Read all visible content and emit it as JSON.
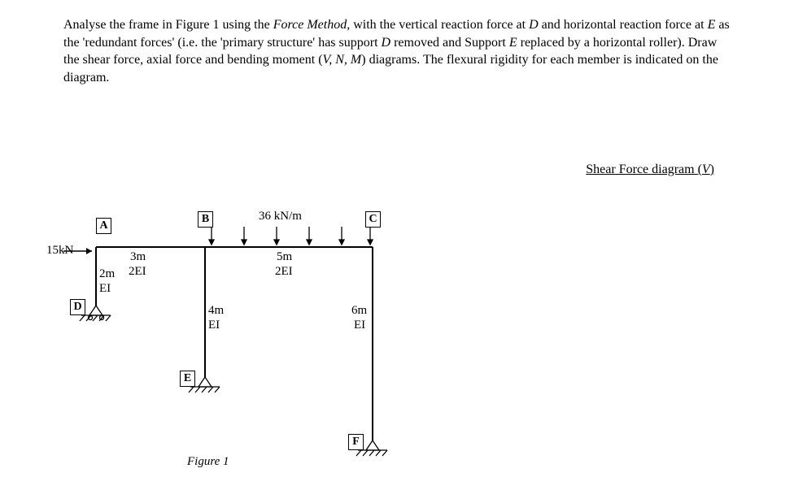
{
  "problem": {
    "p1a": "Analyse the frame in Figure 1 using the ",
    "p1b": "Force Method",
    "p1c": ", with the vertical reaction force at ",
    "p1d": "D",
    "p1e": " and horizontal reaction force at ",
    "p1f": "E",
    "p1g": " as the 'redundant forces' (i.e. the 'primary structure' has support ",
    "p1h": "D",
    "p1i": " removed and Support ",
    "p1j": "E",
    "p1k": " replaced by a horizontal roller). Draw the shear force, axial force and bending moment (",
    "p1l": "V, N, M",
    "p1m": ") diagrams. The flexural rigidity for each member is indicated on the diagram."
  },
  "shear_title": "Shear Force diagram (",
  "shear_v": "V",
  "shear_close": ")",
  "nodes": {
    "A": "A",
    "B": "B",
    "C": "C",
    "D": "D",
    "E": "E",
    "F": "F"
  },
  "labels": {
    "load15": "15kN",
    "udl": "36 kN/m",
    "ab_len": "3m",
    "ab_ei": "2EI",
    "ad_len": "2m",
    "ad_ei": "EI",
    "be_len": "4m",
    "be_ei": "EI",
    "bc_len": "5m",
    "bc_ei": "2EI",
    "cf_len": "6m",
    "cf_ei": "EI"
  },
  "caption": "Figure 1"
}
